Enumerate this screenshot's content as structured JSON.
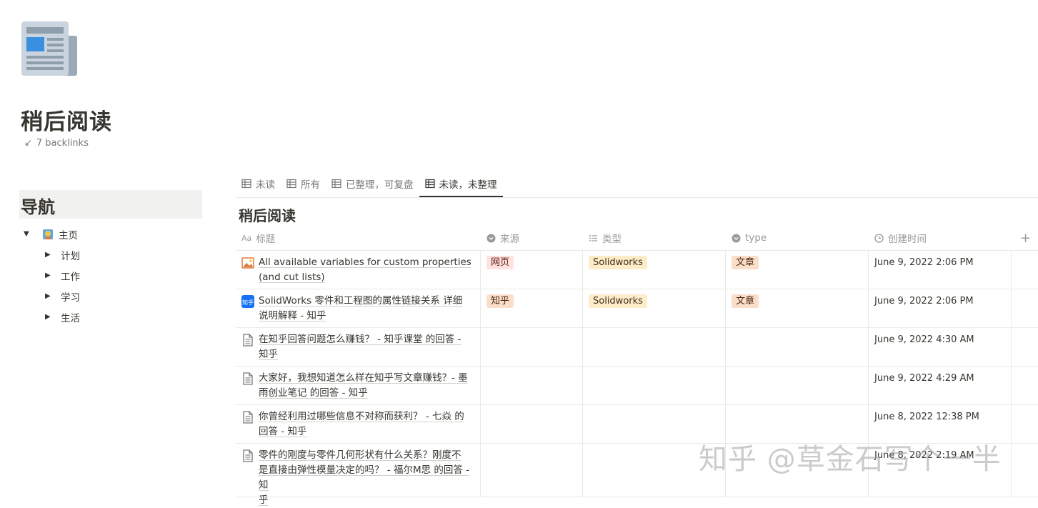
{
  "page": {
    "icon": "newspaper-icon",
    "title": "稍后阅读",
    "backlinks": "7 backlinks"
  },
  "nav": {
    "heading": "导航",
    "root": {
      "label": "主页",
      "icon": "home-emoji-icon"
    },
    "children": [
      "计划",
      "工作",
      "学习",
      "生活"
    ]
  },
  "tabs": [
    {
      "label": "未读",
      "active": false
    },
    {
      "label": "所有",
      "active": false
    },
    {
      "label": "已整理，可复盘",
      "active": false
    },
    {
      "label": "未读，未整理",
      "active": true
    }
  ],
  "database": {
    "title": "稍后阅读",
    "columns": [
      {
        "label": "标题",
        "icon": "text-aa-icon"
      },
      {
        "label": "来源",
        "icon": "select-icon"
      },
      {
        "label": "类型",
        "icon": "list-icon"
      },
      {
        "label": "type",
        "icon": "select-icon"
      },
      {
        "label": "创建时间",
        "icon": "clock-icon"
      }
    ],
    "add_column": "+",
    "rows": [
      {
        "icon": "image-icon",
        "title_l1": "All available variables for custom properties",
        "title_l2": "(and cut lists)",
        "source": "网页",
        "category": "Solidworks",
        "type": "文章",
        "created": "June 9, 2022 2:06 PM"
      },
      {
        "icon": "zhihu-icon",
        "title_l1": "SolidWorks 零件和工程图的属性链接关系 详细",
        "title_l2": "说明解释 - 知乎",
        "source": "知乎",
        "category": "Solidworks",
        "type": "文章",
        "created": "June 9, 2022 2:06 PM"
      },
      {
        "icon": "doc-icon",
        "title_l1": "在知乎回答问题怎么赚钱？ - 知乎课堂 的回答 -",
        "title_l2": "知乎",
        "source": "",
        "category": "",
        "type": "",
        "created": "June 9, 2022 4:30 AM"
      },
      {
        "icon": "doc-icon",
        "title_l1": "大家好，我想知道怎么样在知乎写文章赚钱？- 墨",
        "title_l2": "雨创业笔记 的回答 - 知乎",
        "source": "",
        "category": "",
        "type": "",
        "created": "June 9, 2022 4:29 AM"
      },
      {
        "icon": "doc-icon",
        "title_l1": "你曾经利用过哪些信息不对称而获利？ - 七焱 的",
        "title_l2": "回答 - 知乎",
        "source": "",
        "category": "",
        "type": "",
        "created": "June 8, 2022 12:38 PM"
      },
      {
        "icon": "doc-icon",
        "title_l1": "零件的刚度与零件几何形状有什么关系？刚度不",
        "title_l2": "是直接由弹性模量决定的吗？ - 福尔M思 的回答 - 知",
        "title_l3": "乎",
        "source": "",
        "category": "",
        "type": "",
        "created": "June 8, 2022 2:19 AM"
      }
    ]
  },
  "watermark": "知乎 @草金石写个一半"
}
